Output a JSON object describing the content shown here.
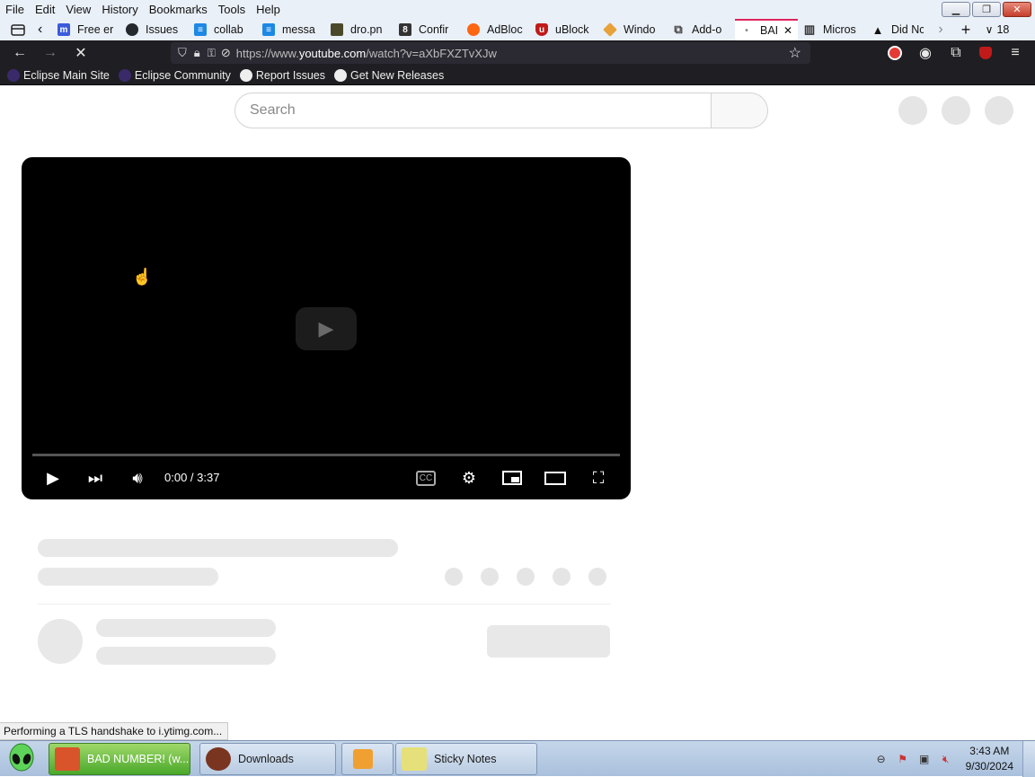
{
  "menubar": {
    "items": [
      "File",
      "Edit",
      "View",
      "History",
      "Bookmarks",
      "Tools",
      "Help"
    ]
  },
  "tabs": {
    "items": [
      {
        "label": "Free er",
        "icon": "m-icon",
        "color": "#3b5bdb"
      },
      {
        "label": "Issues",
        "icon": "github-icon",
        "color": "#24292e"
      },
      {
        "label": "collab",
        "icon": "doc-icon",
        "color": "#1e88e5"
      },
      {
        "label": "messa",
        "icon": "doc-icon",
        "color": "#1e88e5"
      },
      {
        "label": "dro.pn",
        "icon": "image-icon",
        "color": "#4a4a2a"
      },
      {
        "label": "Confir",
        "icon": "eight-icon",
        "color": "#333333"
      },
      {
        "label": "AdBloc",
        "icon": "firefox-icon",
        "color": "#ff6611"
      },
      {
        "label": "uBlock",
        "icon": "ublock-icon",
        "color": "#c01a1a"
      },
      {
        "label": "Windo",
        "icon": "diamond-icon",
        "color": "#e8a23a"
      },
      {
        "label": "Add-o",
        "icon": "puzzle-icon",
        "color": "#444444"
      },
      {
        "label": "BAI",
        "icon": "youtube-icon",
        "color": "#888888",
        "active": true
      },
      {
        "label": "Micros",
        "icon": "columns-icon",
        "color": "#333333"
      },
      {
        "label": "Did Nc",
        "icon": "warning-icon",
        "color": "#111111"
      }
    ],
    "tab_count": "18"
  },
  "navbar": {
    "url_prefix": "https://www.",
    "url_domain": "youtube.com",
    "url_suffix": "/watch?v=aXbFXZTvXJw"
  },
  "bookmarks": {
    "items": [
      {
        "label": "Eclipse Main Site",
        "icon": "eclipse-icon"
      },
      {
        "label": "Eclipse Community",
        "icon": "eclipse-icon"
      },
      {
        "label": "Report Issues",
        "icon": "github-icon"
      },
      {
        "label": "Get New Releases",
        "icon": "github-icon"
      }
    ]
  },
  "page": {
    "search_placeholder": "Search",
    "player": {
      "time_display": "0:00 / 3:37"
    }
  },
  "status_tip": "Performing a TLS handshake to i.ytimg.com...",
  "taskbar": {
    "buttons": [
      {
        "label": "BAD NUMBER! (w...",
        "active": true
      },
      {
        "label": "Downloads"
      },
      {
        "label": ""
      },
      {
        "label": "Sticky Notes"
      }
    ],
    "clock_time": "3:43 AM",
    "clock_date": "9/30/2024"
  }
}
